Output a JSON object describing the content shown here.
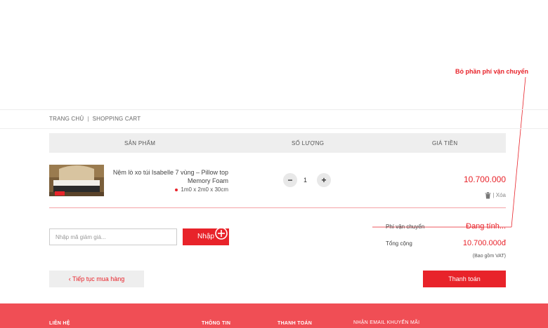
{
  "annotation": {
    "text": "Bỏ phần phí vận chuyển"
  },
  "breadcrumb": {
    "home": "TRANG CHỦ",
    "separator": "|",
    "current": "SHOPPING CART"
  },
  "table": {
    "headers": {
      "product": "SẢN PHẨM",
      "quantity": "SỐ LƯỢNG",
      "price": "GIÁ TIỀN"
    }
  },
  "item": {
    "name": "Nệm lò xo túi Isabelle 7 vùng – Pillow top Memory Foam",
    "size": "1m0 x 2m0 x 30cm",
    "quantity": "1",
    "minus": "−",
    "plus": "+",
    "price": "10.700.000",
    "delete_label": "Xóa",
    "delete_sep": "|"
  },
  "coupon": {
    "placeholder": "Nhập mã giảm giá...",
    "button": "Nhập"
  },
  "summary": {
    "shipping_label": "Phí vận chuyển",
    "shipping_value": "Đang tính...",
    "total_label": "Tổng cộng",
    "total_value": "10.700.000đ",
    "vat_note": "(Bao gồm VAT)"
  },
  "actions": {
    "continue": "‹ Tiếp tục mua hàng",
    "checkout": "Thanh toán"
  },
  "footer": {
    "contact": "LIÊN HỆ",
    "info": "THÔNG TIN",
    "payment": "THANH TOÁN",
    "newsletter": "NHẬN EMAIL KHUYẾN MÃI"
  },
  "colors": {
    "accent": "#e8232a",
    "footer": "#f04e55",
    "header_bg": "#eeeeee"
  }
}
